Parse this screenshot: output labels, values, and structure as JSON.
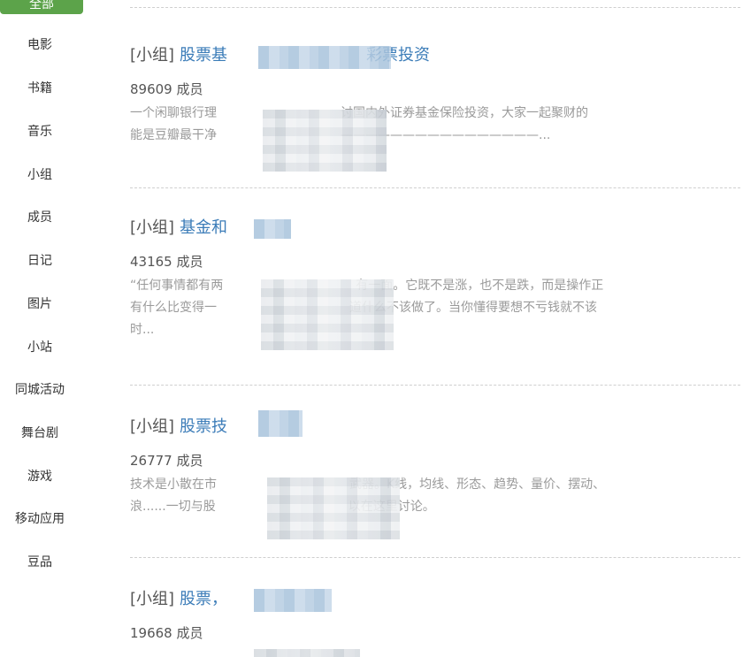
{
  "sidebar": {
    "active": "全部",
    "items": [
      "电影",
      "书籍",
      "音乐",
      "小组",
      "成员",
      "日记",
      "图片",
      "小站",
      "同城活动",
      "舞台剧",
      "游戏",
      "移动应用",
      "豆品"
    ]
  },
  "results": [
    {
      "tag": "[小组]",
      "title_start": "股票基",
      "title_end": "彩票投资",
      "members": "89609 成员",
      "snippet_lines": [
        [
          "一个闲聊银行理",
          "讨国内外证券基金保险投资，大家一起聚财的"
        ],
        [
          "能是豆瓣最干净",
          "————————————————..."
        ]
      ]
    },
    {
      "tag": "[小组]",
      "title_start": "基金和",
      "title_end": "",
      "members": "43165 成员",
      "snippet_lines": [
        [
          "“任何事情都有两",
          "有一面。它既不是涨，也不是跌，而是操作正"
        ],
        [
          "有什么比变得一",
          "道什么不该做了。当你懂得要想不亏钱就不该"
        ],
        [
          "时...",
          ""
        ]
      ]
    },
    {
      "tag": "[小组]",
      "title_start": "股票技",
      "title_end": "",
      "members": "26777 成员",
      "snippet_lines": [
        [
          "技术是小散在市",
          "武器。K线，均线、形态、趋势、量价、摆动、"
        ],
        [
          "浪......一切与股",
          "以在这里讨论。"
        ]
      ]
    },
    {
      "tag": "[小组]",
      "title_start": "股票，",
      "title_end": "",
      "members": "19668 成员",
      "snippet_lines": []
    }
  ]
}
